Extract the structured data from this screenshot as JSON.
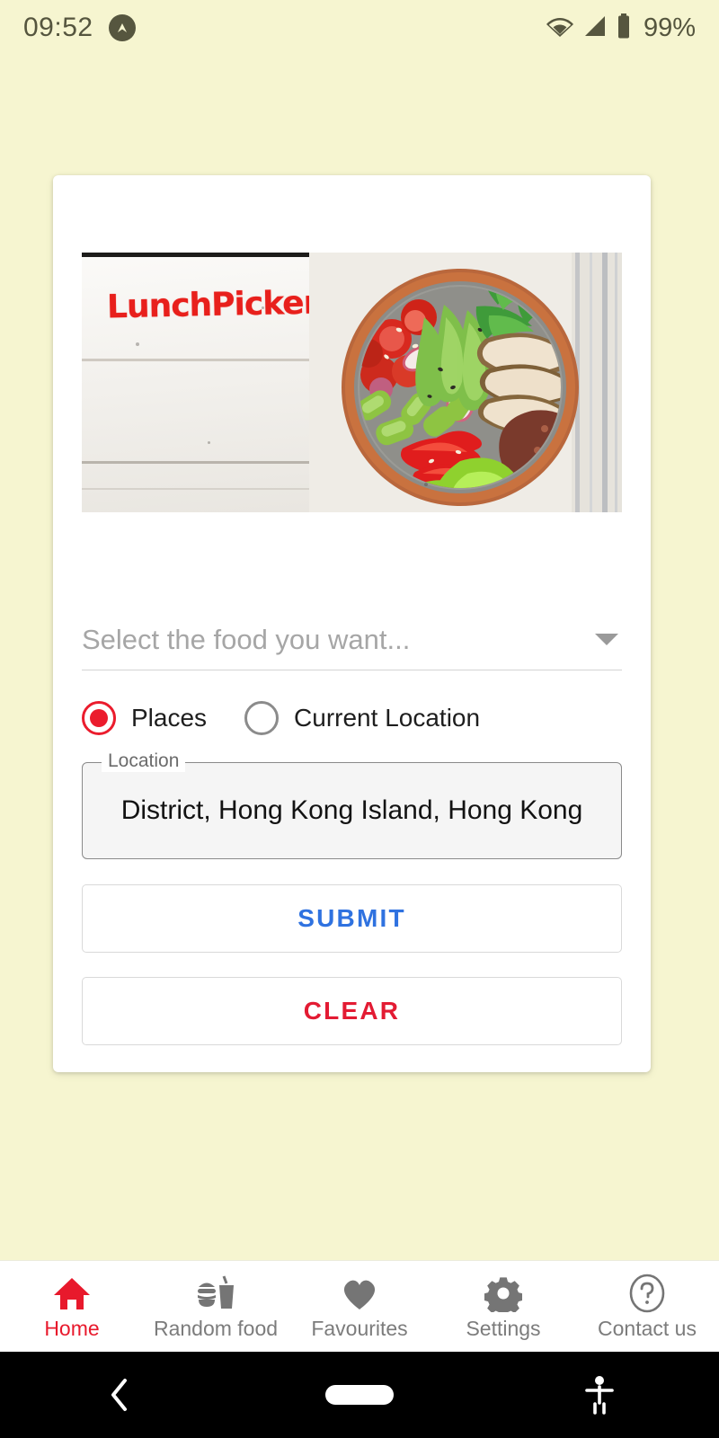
{
  "status_bar": {
    "time": "09:52",
    "app_badge_icon": "caret-up-circle-icon",
    "wifi_icon": "wifi-icon",
    "signal_icon": "cell-signal-icon",
    "battery_icon": "battery-full-icon",
    "battery_percent": "99%",
    "foreground_color": "#56563f"
  },
  "theme": {
    "page_background": "#f6f5d0",
    "card_background": "#ffffff",
    "accent_red": "#eb1c2d",
    "accent_blue": "#2f72e0",
    "muted_text": "#7c7c7c"
  },
  "card": {
    "hero": {
      "logo_text": "LunchPicker",
      "logo_color": "#e8201c",
      "photo_alt": "salad-bowl-photo"
    },
    "food_select": {
      "placeholder": "Select the food you want...",
      "value": "",
      "caret_icon": "chevron-down-icon"
    },
    "location_mode": {
      "selected": "Places",
      "options": [
        {
          "label": "Places",
          "selected": true
        },
        {
          "label": "Current Location",
          "selected": false
        }
      ]
    },
    "location_field": {
      "legend": "Location",
      "value": "District, Hong Kong Island, Hong Kong"
    },
    "buttons": {
      "submit_label": "SUBMIT",
      "clear_label": "CLEAR"
    }
  },
  "bottom_nav": {
    "items": [
      {
        "label": "Home",
        "icon": "home-icon",
        "active": true
      },
      {
        "label": "Random food",
        "icon": "fast-food-icon",
        "active": false
      },
      {
        "label": "Favourites",
        "icon": "heart-icon",
        "active": false
      },
      {
        "label": "Settings",
        "icon": "gear-icon",
        "active": false
      },
      {
        "label": "Contact us",
        "icon": "help-circle-icon",
        "active": false
      }
    ]
  },
  "system_nav": {
    "back_icon": "back-chevron-icon",
    "home_icon": "home-pill-icon",
    "accessibility_icon": "accessibility-icon"
  }
}
